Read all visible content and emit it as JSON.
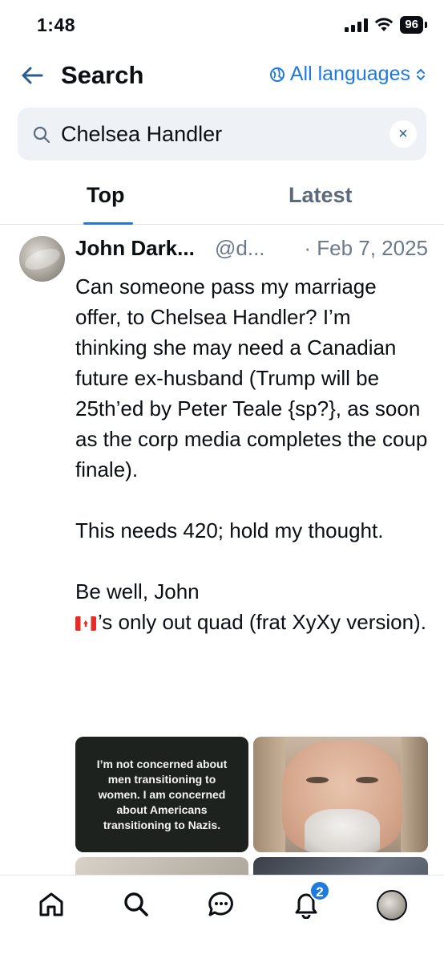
{
  "status_bar": {
    "time": "1:48",
    "battery": "96"
  },
  "header": {
    "title": "Search",
    "language_label": "All languages"
  },
  "search": {
    "query": "Chelsea Handler",
    "clear_icon": "×"
  },
  "tabs": [
    {
      "label": "Top",
      "active": true
    },
    {
      "label": "Latest",
      "active": false
    }
  ],
  "post": {
    "author": "John Dark...",
    "handle": "@d...",
    "date": "· Feb 7, 2025",
    "paragraph_1": "Can someone pass my marriage offer, to Chelsea Handler? I’m thinking she may need a Canadian future ex-husband (Trump will be 25th’ed by Peter Teale {sp?}, as soon as the corp media completes the coup finale).",
    "paragraph_2": "This needs 420; hold my thought.",
    "paragraph_3_line_1": "Be well, John",
    "paragraph_3_line_2": "’s only out quad (frat XyXy version).",
    "flag_icon": "canada-flag-icon",
    "image_quote_text": "I’m not concerned about men transitioning to women. I am concerned about Americans transitioning to Nazis."
  },
  "tab_bar": {
    "items": [
      "home-icon",
      "search-icon",
      "chat-icon",
      "bell-icon",
      "profile-avatar"
    ],
    "notification_count": "2"
  },
  "colors": {
    "accent": "#1f7ae0",
    "text": "#0b0f14",
    "muted": "#6b7a8c",
    "search_bg": "#eef2f6"
  }
}
